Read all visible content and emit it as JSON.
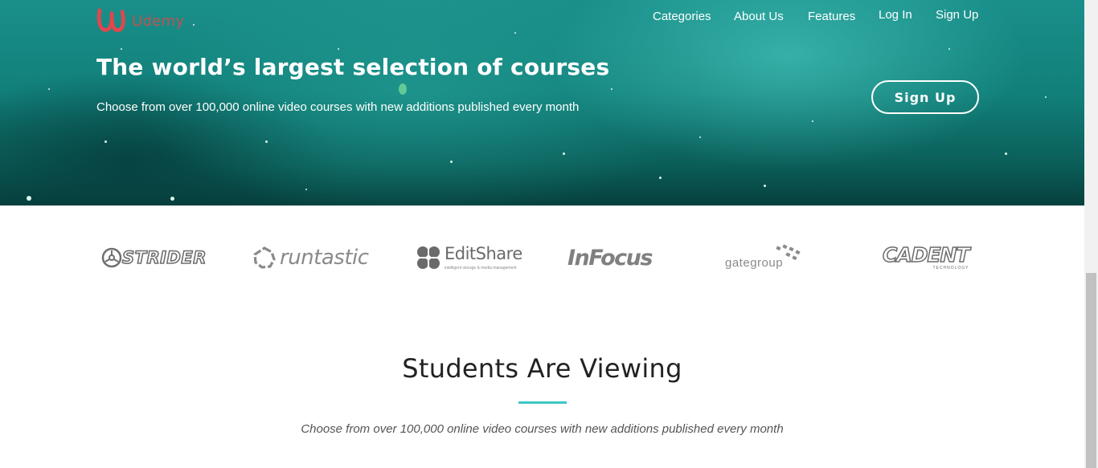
{
  "brand": {
    "name": "Udemy",
    "color": "#d94a4a"
  },
  "nav": {
    "items": [
      "Categories",
      "About Us",
      "Features",
      "Log In",
      "Sign Up"
    ]
  },
  "hero": {
    "title": "The world’s largest selection of courses",
    "subtitle": "Choose from over 100,000 online video courses with new additions published every month",
    "cta_label": "Sign Up"
  },
  "partners": {
    "strider": "STRIDER",
    "runtastic": "runtastic",
    "editshare": "EditShare",
    "editshare_tagline": "intelligent storage & media management",
    "infocus": "InFocus",
    "gategroup": "gategroup",
    "cadent": "CADENT",
    "cadent_tagline": "TECHNOLOGY"
  },
  "section": {
    "title": "Students Are Viewing",
    "subtitle": "Choose from over 100,000 online video courses with new additions published every month",
    "accent_color": "#3cc7c4"
  }
}
